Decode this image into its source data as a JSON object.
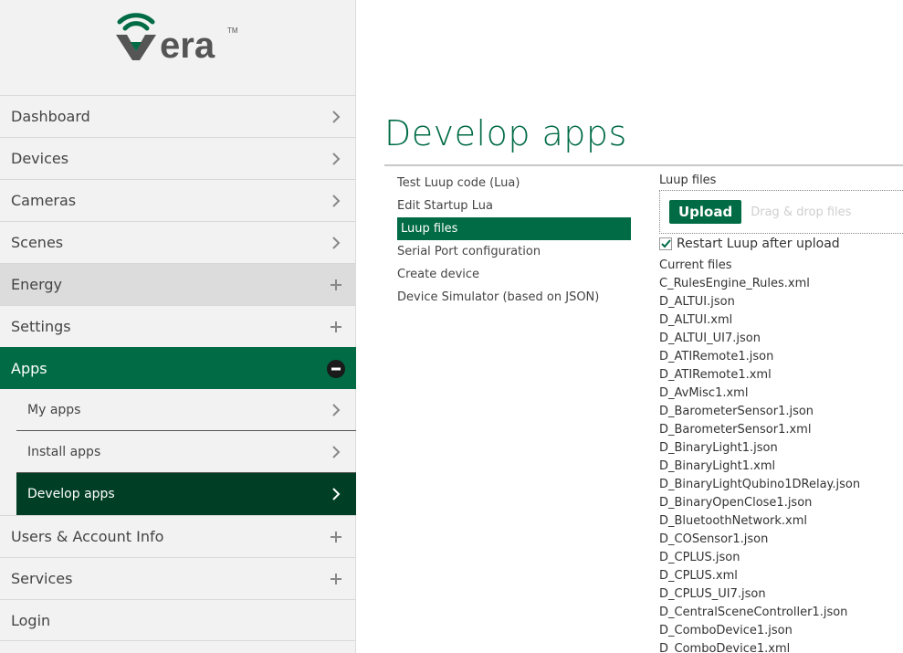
{
  "brand": {
    "name": "vera",
    "accent": "#006b45",
    "dark_accent": "#003f26"
  },
  "nav": {
    "items": [
      {
        "label": "Dashboard",
        "control": "chevron-right-icon"
      },
      {
        "label": "Devices",
        "control": "chevron-right-icon"
      },
      {
        "label": "Cameras",
        "control": "chevron-right-icon"
      },
      {
        "label": "Scenes",
        "control": "chevron-right-icon"
      },
      {
        "label": "Energy",
        "control": "plus-icon"
      },
      {
        "label": "Settings",
        "control": "plus-icon"
      },
      {
        "label": "Apps",
        "control": "minus-circle-icon"
      },
      {
        "label": "Users & Account Info",
        "control": "plus-icon"
      },
      {
        "label": "Services",
        "control": "plus-icon"
      },
      {
        "label": "Login",
        "control": ""
      }
    ],
    "apps_sub": [
      {
        "label": "My apps"
      },
      {
        "label": "Install apps"
      },
      {
        "label": "Develop apps"
      }
    ]
  },
  "main": {
    "title": "Develop apps",
    "submenu": [
      "Test Luup code (Lua)",
      "Edit Startup Lua",
      "Luup files",
      "Serial Port configuration",
      "Create device",
      "Device Simulator (based on JSON)"
    ],
    "selected_submenu": "Luup files"
  },
  "luup_files": {
    "title": "Luup files",
    "upload_label": "Upload",
    "drag_text": "Drag & drop files",
    "restart_label": "Restart Luup after upload",
    "restart_checked": true,
    "current_label": "Current files",
    "files": [
      "C_RulesEngine_Rules.xml",
      "D_ALTUI.json",
      "D_ALTUI.xml",
      "D_ALTUI_UI7.json",
      "D_ATIRemote1.json",
      "D_ATIRemote1.xml",
      "D_AvMisc1.xml",
      "D_BarometerSensor1.json",
      "D_BarometerSensor1.xml",
      "D_BinaryLight1.json",
      "D_BinaryLight1.xml",
      "D_BinaryLightQubino1DRelay.json",
      "D_BinaryOpenClose1.json",
      "D_BluetoothNetwork.xml",
      "D_COSensor1.json",
      "D_CPLUS.json",
      "D_CPLUS.xml",
      "D_CPLUS_UI7.json",
      "D_CentralSceneController1.json",
      "D_ComboDevice1.json",
      "D_ComboDevice1.xml"
    ]
  }
}
